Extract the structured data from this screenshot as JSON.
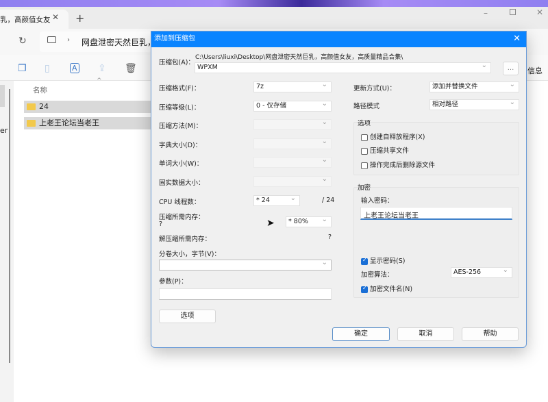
{
  "explorer": {
    "tab_title": "乳，高颜值女友",
    "address_text": "网盘泄密天然巨乳，",
    "details_label": "信息",
    "column_name": "名称",
    "sidebar_fragment": "er",
    "files": [
      {
        "name": "24"
      },
      {
        "name": "上老王论坛当老王"
      }
    ]
  },
  "dialog": {
    "title": "添加到压缩包",
    "archive_label": "压缩包(A)：",
    "archive_path": "C:\\Users\\liuxi\\Desktop\\网盘泄密天然巨乳，高颜值女友，高质量精品合集\\",
    "archive_name": "WPXM",
    "browse_label": "...",
    "format_label": "压缩格式(F)：",
    "format_value": "7z",
    "level_label": "压缩等级(L)：",
    "level_value": "0 - 仅存储",
    "method_label": "压缩方法(M)：",
    "dict_label": "字典大小(D)：",
    "word_label": "单词大小(W)：",
    "solid_label": "固实数据大小：",
    "cpu_label": "CPU 线程数：",
    "cpu_value": "* 24",
    "cpu_max": "/ 24",
    "mem_label": "压缩所需内存：",
    "mem_value": "?",
    "mem_percent": "* 80%",
    "decomp_label": "解压缩所需内存：",
    "decomp_value": "?",
    "split_label": "分卷大小，字节(V)：",
    "split_value": "",
    "params_label": "参数(P)：",
    "params_value": "",
    "options_button": "选项",
    "update_label": "更新方式(U)：",
    "update_value": "添加并替换文件",
    "path_label": "路径模式",
    "path_value": "相对路径",
    "options_group": "选项",
    "opt_sfx": "创建自释放程序(X)",
    "opt_shared": "压缩共享文件",
    "opt_delete": "操作完成后删除源文件",
    "enc_group": "加密",
    "pwd_label": "输入密码：",
    "pwd_value": "上老王论坛当老王",
    "show_pwd": "显示密码(S)",
    "enc_method_label": "加密算法：",
    "enc_method_value": "AES-256",
    "enc_names": "加密文件名(N)",
    "ok": "确定",
    "cancel": "取消",
    "help": "帮助"
  }
}
